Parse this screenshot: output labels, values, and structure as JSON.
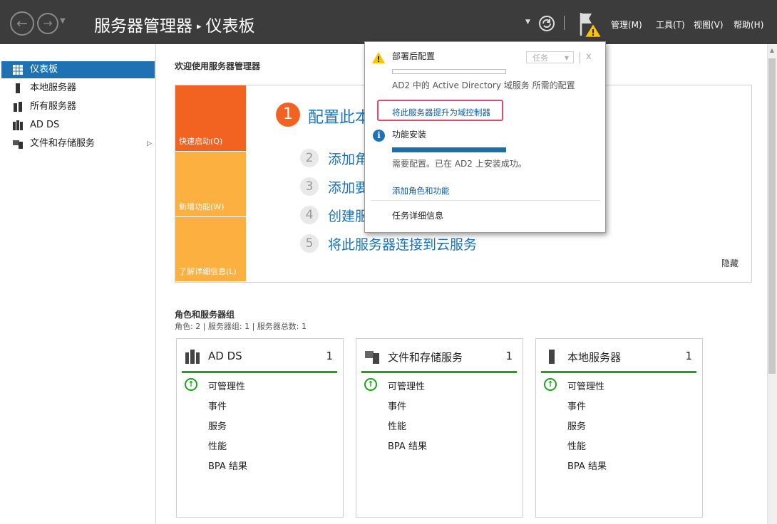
{
  "titlebar": {
    "breadcrumb_root": "服务器管理器",
    "breadcrumb_separator": "▸",
    "breadcrumb_current": "仪表板",
    "menus": [
      "管理(M)",
      "工具(T)",
      "视图(V)",
      "帮助(H)"
    ],
    "icons": [
      "back-arrow-icon",
      "forward-arrow-icon",
      "dropdown-arrow-icon",
      "refresh-icon",
      "notification-flag-icon",
      "warning-icon"
    ]
  },
  "sidebar": {
    "items": [
      {
        "label": "仪表板",
        "icon": "dashboard-grid-icon",
        "active": true
      },
      {
        "label": "本地服务器",
        "icon": "server-icon"
      },
      {
        "label": "所有服务器",
        "icon": "servers-icon"
      },
      {
        "label": "AD DS",
        "icon": "ad-ds-icon"
      },
      {
        "label": "文件和存储服务",
        "icon": "file-storage-icon",
        "expand_arrow": "▷"
      }
    ]
  },
  "welcome": {
    "title": "欢迎使用服务器管理器",
    "tiles": [
      "快速启动(Q)",
      "新增功能(W)",
      "了解详细信息(L)"
    ],
    "steps": [
      {
        "num": "1",
        "text": "配置此本"
      },
      {
        "num": "2",
        "text": "添加角"
      },
      {
        "num": "3",
        "text": "添加要"
      },
      {
        "num": "4",
        "text": "创建服"
      },
      {
        "num": "5",
        "text": "将此服务器连接到云服务"
      }
    ],
    "hide": "隐藏"
  },
  "roles": {
    "title": "角色和服务器组",
    "summary": "角色: 2 | 服务器组: 1 | 服务器总数: 1",
    "cards": [
      {
        "title": "AD DS",
        "count": "1",
        "rows": [
          "可管理性",
          "事件",
          "服务",
          "性能",
          "BPA 结果"
        ]
      },
      {
        "title": "文件和存储服务",
        "count": "1",
        "rows": [
          "可管理性",
          "事件",
          "性能",
          "BPA 结果"
        ]
      },
      {
        "title": "本地服务器",
        "count": "1",
        "rows": [
          "可管理性",
          "事件",
          "服务",
          "性能",
          "BPA 结果"
        ]
      }
    ]
  },
  "notification": {
    "section1_title": "部署后配置",
    "task_button": "任务",
    "close": "x",
    "section1_text": "AD2 中的 Active Directory 域服务 所需的配置",
    "promote_link": "将此服务器提升为域控制器",
    "section2_title": "功能安装",
    "section2_text": "需要配置。已在 AD2 上安装成功。",
    "section2_progress": 1.0,
    "add_roles_link": "添加角色和功能",
    "task_details": "任务详细信息"
  },
  "colors": {
    "titlebar": "#3c3c3c",
    "accent": "#1e72b4",
    "orange": "#f26322",
    "tile_light": "#fbb040",
    "ok_green": "#1aa51a",
    "highlight": "#e8476a"
  }
}
